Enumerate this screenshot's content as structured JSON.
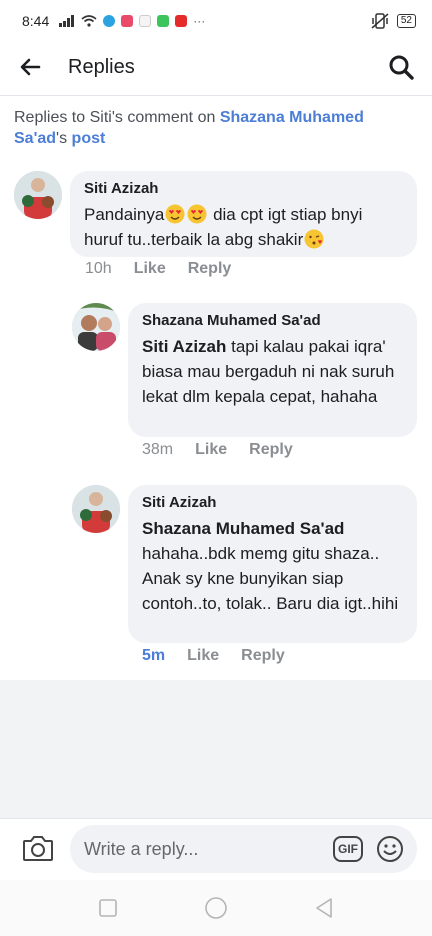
{
  "status_bar": {
    "time": "8:44",
    "battery": "52"
  },
  "header": {
    "title": "Replies"
  },
  "context": {
    "prefix": "Replies to Siti's comment on ",
    "post_owner": "Shazana Muhamed Sa'ad",
    "possessive": "'s ",
    "post_link": "post"
  },
  "comments": [
    {
      "author": "Siti Azizah",
      "text_part1": "Pandainya",
      "text_part2": " dia cpt igt stiap bnyi huruf tu..terbaik la abg shakir",
      "time": "10h",
      "like": "Like",
      "reply": "Reply"
    },
    {
      "author": "Shazana Muhamed Sa'ad",
      "mention": "Siti Azizah",
      "text": " tapi kalau pakai iqra' biasa mau bergaduh ni nak suruh lekat dlm kepala cepat, hahaha",
      "time": "38m",
      "like": "Like",
      "reply": "Reply"
    },
    {
      "author": "Siti Azizah",
      "mention": "Shazana Muhamed Sa'ad",
      "text": "hahaha..bdk memg gitu shaza.. Anak sy kne bunyikan siap contoh..to, tolak.. Baru dia igt..hihi",
      "time": "5m",
      "like": "Like",
      "reply": "Reply"
    }
  ],
  "reply_bar": {
    "placeholder": "Write a reply...",
    "gif_label": "GIF"
  },
  "colors": {
    "link": "#4c7ed6",
    "bubble": "#f0f2f5",
    "muted": "#8a8d91"
  }
}
